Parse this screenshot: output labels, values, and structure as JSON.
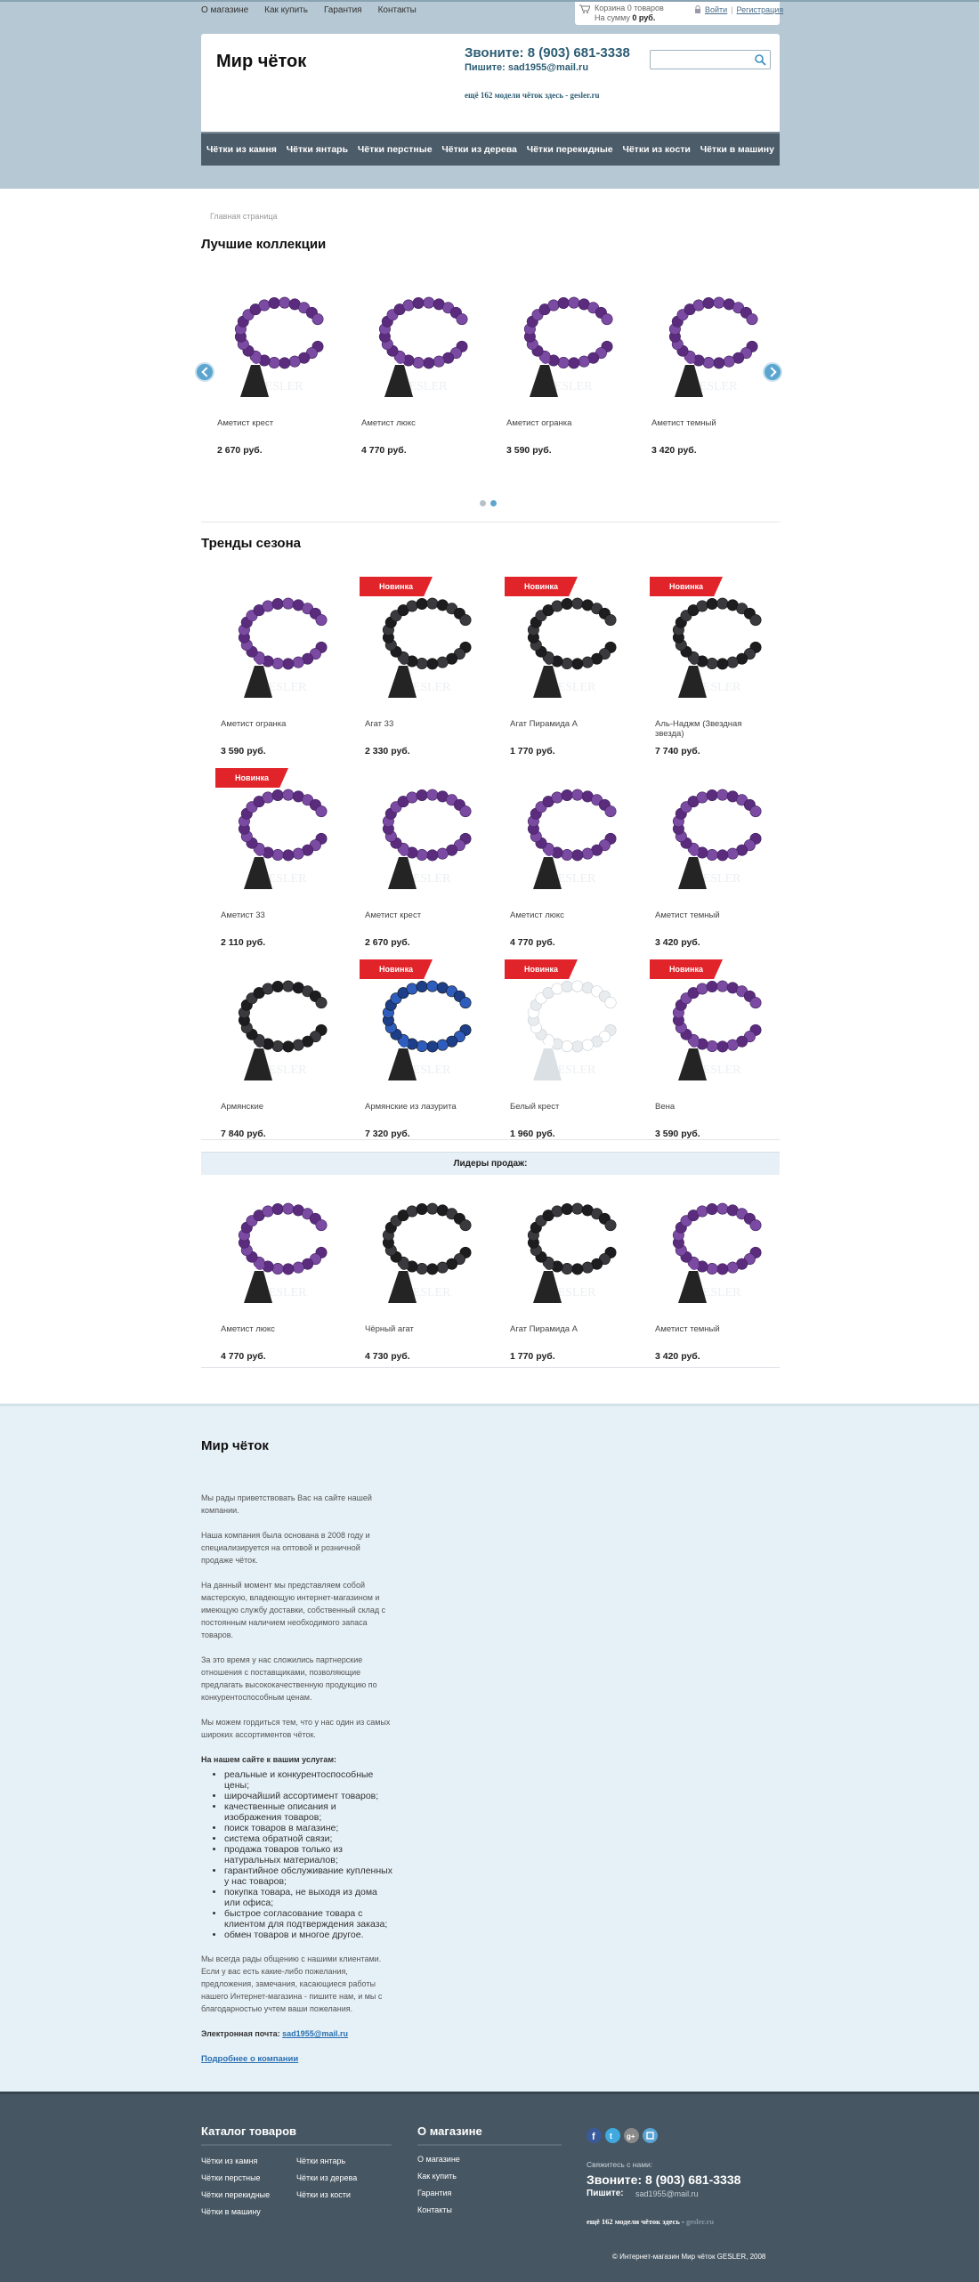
{
  "topnav": [
    "О магазине",
    "Как купить",
    "Гарантия",
    "Контакты"
  ],
  "cart": {
    "line1": "Корзина 0 товаров",
    "line2_prefix": "На сумму ",
    "line2_value": "0 руб.",
    "login": "Войти",
    "register": "Регистрация"
  },
  "header": {
    "title": "Мир чёток",
    "phone": "Звоните: 8 (903) 681-3338",
    "email": "Пишите: sad1955@mail.ru",
    "more_models": "ещё 162 модели чёток здесь -  gesler.ru",
    "search_placeholder": ""
  },
  "mainnav": [
    "Чётки из камня",
    "Чётки янтарь",
    "Чётки перстные",
    "Чётки из дерева",
    "Чётки перекидные",
    "Чётки из кости",
    "Чётки в машину"
  ],
  "breadcrumb": "Главная страница",
  "best": {
    "title": "Лучшие коллекции",
    "items": [
      {
        "name": "Аметист крест",
        "price": "2 670 руб."
      },
      {
        "name": "Аметист люкс",
        "price": "4 770 руб."
      },
      {
        "name": "Аметист огранка",
        "price": "3 590 руб."
      },
      {
        "name": "Аметист темный",
        "price": "3 420 руб."
      }
    ]
  },
  "trends": {
    "title": "Тренды сезона",
    "badge": "Новинка",
    "items": [
      {
        "name": "Аметист огранка",
        "price": "3 590 руб.",
        "is_new": false
      },
      {
        "name": "Агат 33",
        "price": "2 330 руб.",
        "is_new": true
      },
      {
        "name": "Агат Пирамида А",
        "price": "1 770 руб.",
        "is_new": true
      },
      {
        "name": "Аль-Наджм (Звездная звезда)",
        "price": "7 740 руб.",
        "is_new": true
      },
      {
        "name": "Аметист 33",
        "price": "2 110 руб.",
        "is_new": true
      },
      {
        "name": "Аметист крест",
        "price": "2 670 руб.",
        "is_new": false
      },
      {
        "name": "Аметист люкс",
        "price": "4 770 руб.",
        "is_new": false
      },
      {
        "name": "Аметист темный",
        "price": "3 420 руб.",
        "is_new": false
      },
      {
        "name": "Армянские",
        "price": "7 840 руб.",
        "is_new": false
      },
      {
        "name": "Армянские из лазурита",
        "price": "7 320 руб.",
        "is_new": true
      },
      {
        "name": "Белый крест",
        "price": "1 960 руб.",
        "is_new": true
      },
      {
        "name": "Вена",
        "price": "3 590 руб.",
        "is_new": true
      }
    ]
  },
  "leaders": {
    "title": "Лидеры продаж:",
    "items": [
      {
        "name": "Аметист люкс",
        "price": "4 770 руб."
      },
      {
        "name": "Чёрный агат",
        "price": "4 730 руб."
      },
      {
        "name": "Агат Пирамида А",
        "price": "1 770 руб."
      },
      {
        "name": "Аметист темный",
        "price": "3 420 руб."
      }
    ]
  },
  "about": {
    "title": "Мир чёток",
    "p1": " Мы рады приветствовать Вас на сайте нашей компании.",
    "p2": "Наша компания была основана в 2008 году и специализируется на оптовой и розничной продаже чёток.",
    "p3": "На данный момент мы представляем собой мастерскую, владеющую интернет-магазином и имеющую службу доставки, собственный склад с постоянным наличием необходимого запаса товаров.",
    "p4": "За это время у нас сложились партнерские отношения с поставщиками, позволяющие предлагать высококачественную продукцию по конкурентоспособным ценам.",
    "p5": "Мы можем гордиться тем, что у нас один из самых широких ассортиментов чёток.",
    "services_title": "На нашем сайте к вашим услугам:",
    "services": [
      "реальные и конкурентоспособные цены;",
      "широчайший ассортимент товаров;",
      "качественные описания и изображения товаров;",
      "поиск товаров в магазине;",
      "система обратной связи;",
      "продажа товаров только из натуральных материалов;",
      "гарантийное обслуживание купленных у нас товаров;",
      "покупка товара, не выходя из дома или офиса;",
      "быстрое согласование товара с клиентом для подтверждения заказа;",
      "обмен товаров и многое другое."
    ],
    "p6": "Мы всегда рады общению с нашими клиентами. Если у вас есть какие-либо пожелания, предложения, замечания, касающиеся работы нашего Интернет-магазина - пишите нам, и мы с благодарностью учтем ваши пожелания.",
    "email_label": "Электронная почта: ",
    "email_value": "sad1955@mail.ru",
    "more_link": "Подробнее о компании"
  },
  "footer": {
    "catalog_title": "Каталог товаров",
    "catalog_col1": [
      "Чётки из камня",
      "Чётки перстные",
      "Чётки перекидные",
      "Чётки в машину"
    ],
    "catalog_col2": [
      "Чётки янтарь",
      "Чётки из дерева",
      "Чётки из кости"
    ],
    "about_title": "О магазине",
    "about_links": [
      "О магазине",
      "Как купить",
      "Гарантия",
      "Контакты"
    ],
    "call_label": "Свяжитесь с нами:",
    "phone": "Звоните: 8 (903) 681-3338",
    "write": "Пишите:",
    "email": "sad1955@mail.ru",
    "more_prefix": "ещё 162 модели чёток здесь - ",
    "more_link": "gesler.ru",
    "copyright": "© Интернет-магазин Мир чёток GESLER, 2008"
  },
  "colors": {
    "accent": "#2c5d74",
    "nav": "#4c5c69",
    "badge": "#e1242a",
    "footer": "#465662",
    "top_band": "#b6c8d3"
  }
}
